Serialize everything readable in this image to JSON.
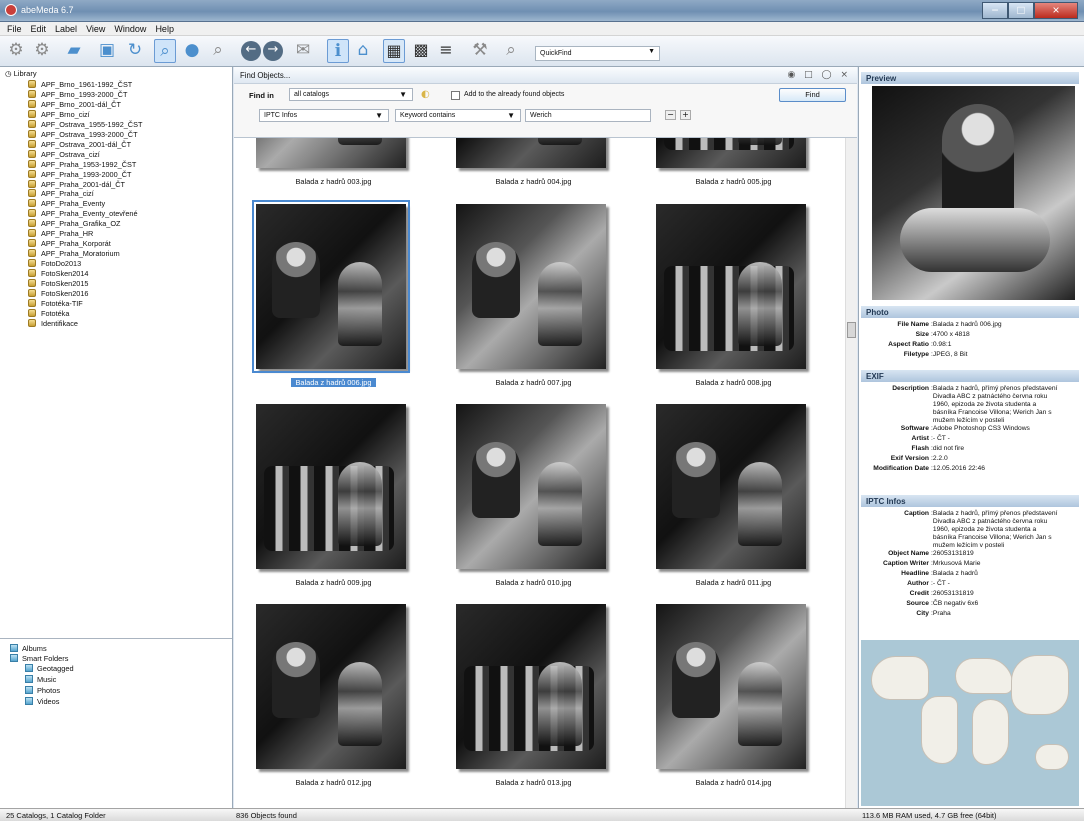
{
  "window": {
    "title": "abeMeda 6.7"
  },
  "menus": [
    "File",
    "Edit",
    "Label",
    "View",
    "Window",
    "Help"
  ],
  "toolbar": {
    "icons": [
      "new-catalog-icon",
      "catalog-settings-icon",
      "add-folder-icon",
      "import-icon",
      "refresh-icon",
      "search-icon",
      "people-icon",
      "zoom-icon",
      "back-icon",
      "forward-icon",
      "share-icon",
      "info-icon",
      "web-icon",
      "large-grid-icon",
      "small-grid-icon",
      "list-view-icon",
      "tools-icon",
      "quickfind-icon"
    ],
    "quickfind_value": "QuickFind"
  },
  "library": {
    "root": "Library",
    "items": [
      "APF_Brno_1961-1992_ČST",
      "APF_Brno_1993-2000_ČT",
      "APF_Brno_2001-dál_ČT",
      "APF_Brno_cizí",
      "APF_Ostrava_1955-1992_ČST",
      "APF_Ostrava_1993-2000_ČT",
      "APF_Ostrava_2001-dál_ČT",
      "APF_Ostrava_cizí",
      "APF_Praha_1953-1992_ČST",
      "APF_Praha_1993-2000_ČT",
      "APF_Praha_2001-dál_ČT",
      "APF_Praha_cizí",
      "APF_Praha_Eventy",
      "APF_Praha_Eventy_otevřené",
      "APF_Praha_Grafika_OZ",
      "APF_Praha_HR",
      "APF_Praha_Korporát",
      "APF_Praha_Moratorium",
      "FotoDo2013",
      "FotoSken2014",
      "FotoSken2015",
      "FotoSken2016",
      "Fototéka-TIF",
      "Fototéka",
      "Identifikace"
    ]
  },
  "albums": {
    "top": [
      "Albums",
      "Smart Folders"
    ],
    "children": [
      "Geotagged",
      "Music",
      "Photos",
      "Videos"
    ]
  },
  "find": {
    "title": "Find Objects...",
    "find_in_label": "Find in",
    "catalog_select": "all catalogs",
    "checkbox_label": "Add to the already found objects",
    "field_select": "IPTC Infos",
    "operator_select": "Keyword contains",
    "keyword": "Werich",
    "find_button": "Find"
  },
  "photos": {
    "top_row": [
      "Balada z hadrů 003.jpg",
      "Balada z hadrů 004.jpg",
      "Balada z hadrů 005.jpg"
    ],
    "items": [
      "Balada z hadrů 006.jpg",
      "Balada z hadrů 007.jpg",
      "Balada z hadrů 008.jpg",
      "Balada z hadrů 009.jpg",
      "Balada z hadrů 010.jpg",
      "Balada z hadrů 011.jpg",
      "Balada z hadrů 012.jpg",
      "Balada z hadrů 013.jpg",
      "Balada z hadrů 014.jpg"
    ]
  },
  "preview": {
    "title": "Preview",
    "photo_section": "Photo",
    "photo": [
      {
        "key": "File Name",
        "value": "Balada z hadrů 006.jpg"
      },
      {
        "key": "Size",
        "value": "4700 x 4818"
      },
      {
        "key": "Aspect Ratio",
        "value": "0.98:1"
      },
      {
        "key": "Filetype",
        "value": "JPEG, 8 Bit"
      }
    ],
    "exif_section": "EXIF",
    "exif": [
      {
        "key": "Description",
        "value": "Balada z hadrů, přímý přenos představení\nDivadla ABC z patnáctého června roku\n1960, epizoda ze života studenta a\nbásníka Francoise Villona; Werich Jan s\nmužem ležícím v posteli"
      },
      {
        "key": "Software",
        "value": "Adobe Photoshop CS3 Windows"
      },
      {
        "key": "Artist",
        "value": "- ČT -"
      },
      {
        "key": "Flash",
        "value": "did not fire"
      },
      {
        "key": "Exif Version",
        "value": "2.2.0"
      },
      {
        "key": "Modification Date",
        "value": "12.05.2016 22:46"
      }
    ],
    "iptc_section": "IPTC Infos",
    "iptc": [
      {
        "key": "Caption",
        "value": "Balada z hadrů, přímý přenos představení\nDivadla ABC z patnáctého června roku\n1960, epizoda ze života studenta a\nbásníka Francoise Villona; Werich Jan s\nmužem ležícím v posteli"
      },
      {
        "key": "Object Name",
        "value": "26053131819"
      },
      {
        "key": "Caption Writer",
        "value": "Mrkusová Marie"
      },
      {
        "key": "Headline",
        "value": "Balada z hadrů"
      },
      {
        "key": "Author",
        "value": "- ČT -"
      },
      {
        "key": "Credit",
        "value": "26053131819"
      },
      {
        "key": "Source",
        "value": "ČB negativ 6x6"
      },
      {
        "key": "City",
        "value": "Praha"
      }
    ]
  },
  "status": {
    "left": "25 Catalogs, 1 Catalog Folder",
    "center": "836 Objects found",
    "right": "113.6 MB RAM used, 4.7 GB free (64bit)"
  }
}
